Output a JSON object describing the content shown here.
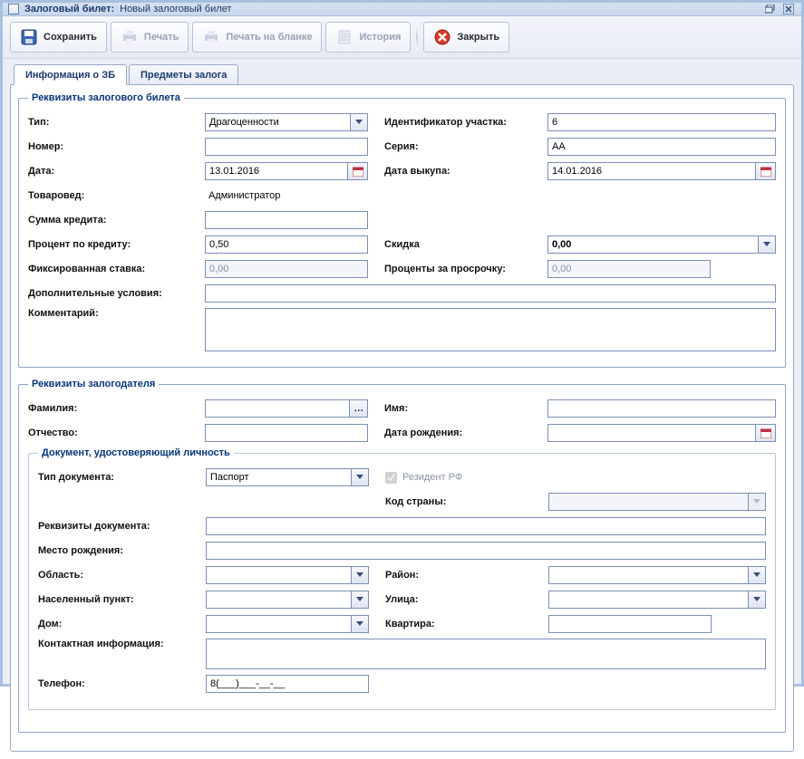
{
  "window": {
    "title_prefix": "Залоговый билет:",
    "title_suffix": "Новый залоговый билет"
  },
  "toolbar": {
    "save": "Сохранить",
    "print": "Печать",
    "print_blank": "Печать на бланке",
    "history": "История",
    "close": "Закрыть"
  },
  "tabs": {
    "info": "Информация о ЗБ",
    "items": "Предметы залога"
  },
  "ticket": {
    "legend": "Реквизиты залогового билета",
    "type_label": "Тип:",
    "type_value": "Драгоценности",
    "site_id_label": "Идентификатор участка:",
    "site_id_value": "6",
    "number_label": "Номер:",
    "number_value": "",
    "series_label": "Серия:",
    "series_value": "АА",
    "date_label": "Дата:",
    "date_value": "13.01.2016",
    "buyout_date_label": "Дата выкупа:",
    "buyout_date_value": "14.01.2016",
    "expert_label": "Товаровед:",
    "expert_value": "Администратор",
    "credit_sum_label": "Сумма кредита:",
    "credit_sum_value": "",
    "credit_percent_label": "Процент по кредиту:",
    "credit_percent_value": "0,50",
    "discount_label": "Скидка",
    "discount_value": "0,00",
    "fixed_rate_label": "Фиксированная ставка:",
    "fixed_rate_value": "0,00",
    "overdue_label": "Проценты за просрочку:",
    "overdue_value": "0,00",
    "extra_label": "Дополнительные условия:",
    "extra_value": "",
    "comment_label": "Комментарий:",
    "comment_value": ""
  },
  "pledger": {
    "legend": "Реквизиты залогодателя",
    "surname_label": "Фамилия:",
    "surname_value": "",
    "name_label": "Имя:",
    "name_value": "",
    "patronymic_label": "Отчество:",
    "patronymic_value": "",
    "dob_label": "Дата рождения:",
    "dob_value": "",
    "doc": {
      "legend": "Документ, удостоверяющий личность",
      "type_label": "Тип документа:",
      "type_value": "Паспорт",
      "resident_label": "Резидент РФ",
      "resident_checked": true,
      "country_label": "Код страны:",
      "country_value": "",
      "req_label": "Реквизиты документа:",
      "req_value": "",
      "birthplace_label": "Место рождения:",
      "birthplace_value": "",
      "region_label": "Область:",
      "region_value": "",
      "district_label": "Район:",
      "district_value": "",
      "city_label": "Населенный пункт:",
      "city_value": "",
      "street_label": "Улица:",
      "street_value": "",
      "house_label": "Дом:",
      "house_value": "",
      "flat_label": "Квартира:",
      "flat_value": "",
      "contact_label": "Контактная информация:",
      "contact_value": "",
      "phone_label": "Телефон:",
      "phone_value": "8(___)___-__-__"
    }
  }
}
